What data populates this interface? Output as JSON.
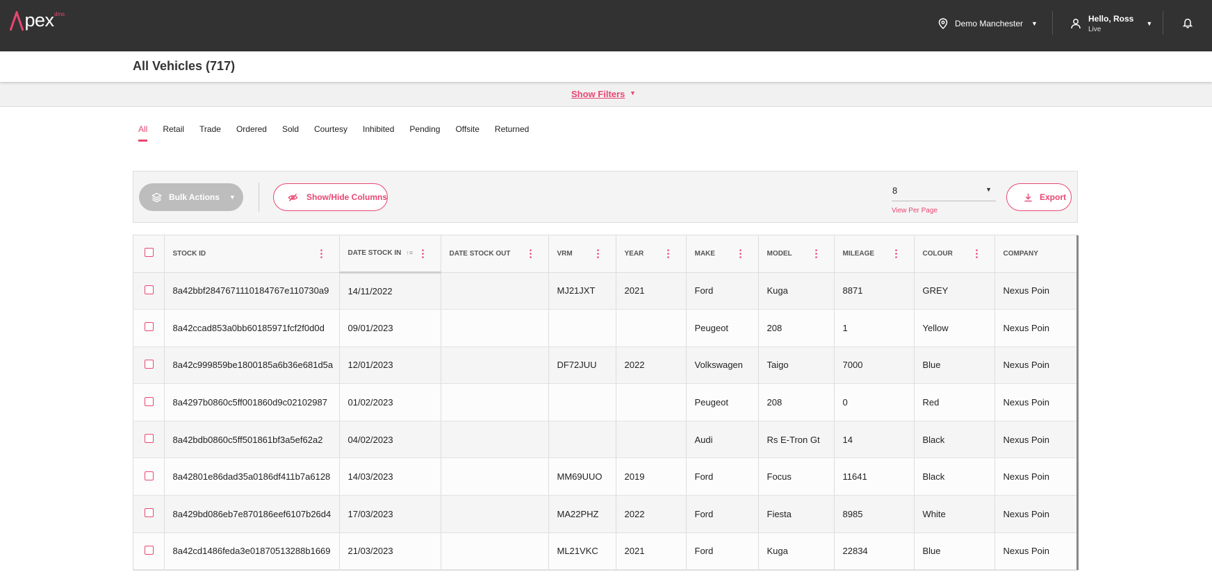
{
  "app": {
    "logo_text": "Apex",
    "logo_sup": "dms",
    "location": "Demo Manchester",
    "user_greeting": "Hello, Ross",
    "user_status": "Live"
  },
  "page": {
    "title": "All Vehicles (717)",
    "show_filters_label": "Show Filters"
  },
  "tabs": [
    "All",
    "Retail",
    "Trade",
    "Ordered",
    "Sold",
    "Courtesy",
    "Inhibited",
    "Pending",
    "Offsite",
    "Returned"
  ],
  "active_tab": "All",
  "toolbar": {
    "bulk_actions_label": "Bulk Actions",
    "show_hide_columns_label": "Show/Hide Columns",
    "per_page_value": "8",
    "per_page_label": "View Per Page",
    "export_label": "Export"
  },
  "table": {
    "columns": [
      "STOCK ID",
      "DATE STOCK IN",
      "DATE STOCK OUT",
      "VRM",
      "YEAR",
      "MAKE",
      "MODEL",
      "MILEAGE",
      "COLOUR",
      "COMPANY"
    ],
    "rows": [
      [
        "8a42bbf2847671110184767e110730a9",
        "14/11/2022",
        "",
        "MJ21JXT",
        "2021",
        "Ford",
        "Kuga",
        "8871",
        "GREY",
        "Nexus Poin"
      ],
      [
        "8a42ccad853a0bb60185971fcf2f0d0d",
        "09/01/2023",
        "",
        "",
        "",
        "Peugeot",
        "208",
        "1",
        "Yellow",
        "Nexus Poin"
      ],
      [
        "8a42c999859be1800185a6b36e681d5a",
        "12/01/2023",
        "",
        "DF72JUU",
        "2022",
        "Volkswagen",
        "Taigo",
        "7000",
        "Blue",
        "Nexus Poin"
      ],
      [
        "8a4297b0860c5ff001860d9c02102987",
        "01/02/2023",
        "",
        "",
        "",
        "Peugeot",
        "208",
        "0",
        "Red",
        "Nexus Poin"
      ],
      [
        "8a42bdb0860c5ff501861bf3a5ef62a2",
        "04/02/2023",
        "",
        "",
        "",
        "Audi",
        "Rs E-Tron Gt",
        "14",
        "Black",
        "Nexus Poin"
      ],
      [
        "8a42801e86dad35a0186df411b7a6128",
        "14/03/2023",
        "",
        "MM69UUO",
        "2019",
        "Ford",
        "Focus",
        "11641",
        "Black",
        "Nexus Poin"
      ],
      [
        "8a429bd086eb7e870186eef6107b26d4",
        "17/03/2023",
        "",
        "MA22PHZ",
        "2022",
        "Ford",
        "Fiesta",
        "8985",
        "White",
        "Nexus Poin"
      ],
      [
        "8a42cd1486feda3e01870513288b1669",
        "21/03/2023",
        "",
        "ML21VKC",
        "2021",
        "Ford",
        "Kuga",
        "22834",
        "Blue",
        "Nexus Poin"
      ]
    ]
  },
  "colors": {
    "accent": "#e94671",
    "topbar": "#323232"
  },
  "icons": [
    "map-pin-icon",
    "user-icon",
    "bell-icon",
    "layers-icon",
    "eye-off-icon",
    "download-icon",
    "kebab-menu-icon",
    "sort-icon",
    "pencil-icon",
    "chevron-down-icon"
  ]
}
